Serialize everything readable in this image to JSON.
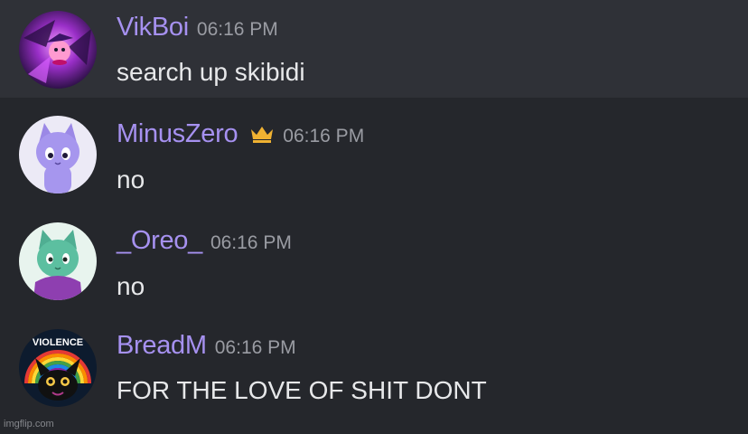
{
  "messages": [
    {
      "username": "VikBoi",
      "timestamp": "06:16 PM",
      "text": "search up skibidi",
      "highlighted": true,
      "avatar_icon": "kirby-avatar-icon",
      "badge": null
    },
    {
      "username": "MinusZero",
      "timestamp": "06:16 PM",
      "text": "no",
      "highlighted": false,
      "avatar_icon": "purple-cat-avatar-icon",
      "badge": "crown-icon"
    },
    {
      "username": "_Oreo_",
      "timestamp": "06:16 PM",
      "text": "no",
      "highlighted": false,
      "avatar_icon": "green-cat-avatar-icon",
      "badge": null
    },
    {
      "username": "BreadM",
      "timestamp": "06:16 PM",
      "text": "FOR THE LOVE OF SHIT DONT",
      "highlighted": false,
      "avatar_icon": "violence-rainbow-cat-avatar-icon",
      "avatar_caption": "VIOLENCE",
      "badge": null
    }
  ],
  "watermark": "imgflip.com",
  "colors": {
    "background": "#25272c",
    "highlight": "#2f3137",
    "username": "#a691f0",
    "timestamp": "#9a9ca3",
    "message_text": "#e7e8ea",
    "crown": "#f0b232"
  }
}
